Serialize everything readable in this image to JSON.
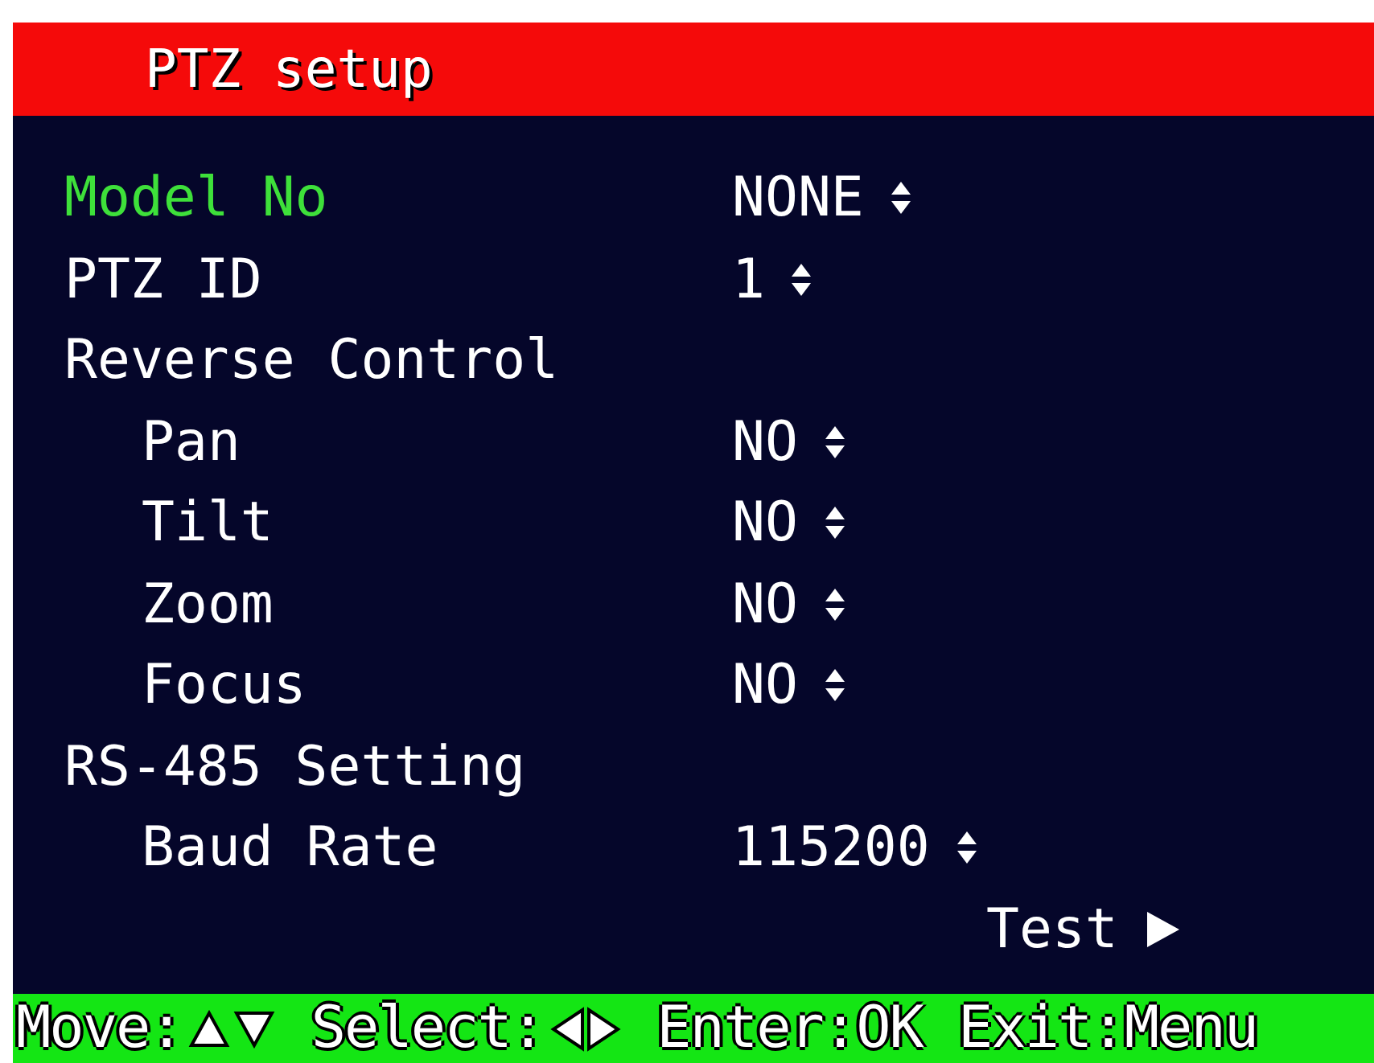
{
  "title": "PTZ setup",
  "rows": [
    {
      "kind": "setting",
      "label": "Model No",
      "value": "NONE",
      "selected": true,
      "indented": false
    },
    {
      "kind": "setting",
      "label": "PTZ ID",
      "value": "1",
      "selected": false,
      "indented": false
    },
    {
      "kind": "header",
      "label": "Reverse Control"
    },
    {
      "kind": "setting",
      "label": "Pan",
      "value": "NO",
      "selected": false,
      "indented": true
    },
    {
      "kind": "setting",
      "label": "Tilt",
      "value": "NO",
      "selected": false,
      "indented": true
    },
    {
      "kind": "setting",
      "label": "Zoom",
      "value": "NO",
      "selected": false,
      "indented": true
    },
    {
      "kind": "setting",
      "label": "Focus",
      "value": "NO",
      "selected": false,
      "indented": true
    },
    {
      "kind": "header",
      "label": "RS-485 Setting"
    },
    {
      "kind": "setting",
      "label": "Baud Rate",
      "value": "115200",
      "selected": false,
      "indented": true
    },
    {
      "kind": "action",
      "label": "Test",
      "selected": false
    }
  ],
  "footer": [
    {
      "kind": "up-down",
      "label": "Move:"
    },
    {
      "kind": "left-right",
      "label": "Select:"
    },
    {
      "kind": "text",
      "label": "Enter:OK"
    },
    {
      "kind": "text",
      "label": "Exit:Menu"
    }
  ]
}
